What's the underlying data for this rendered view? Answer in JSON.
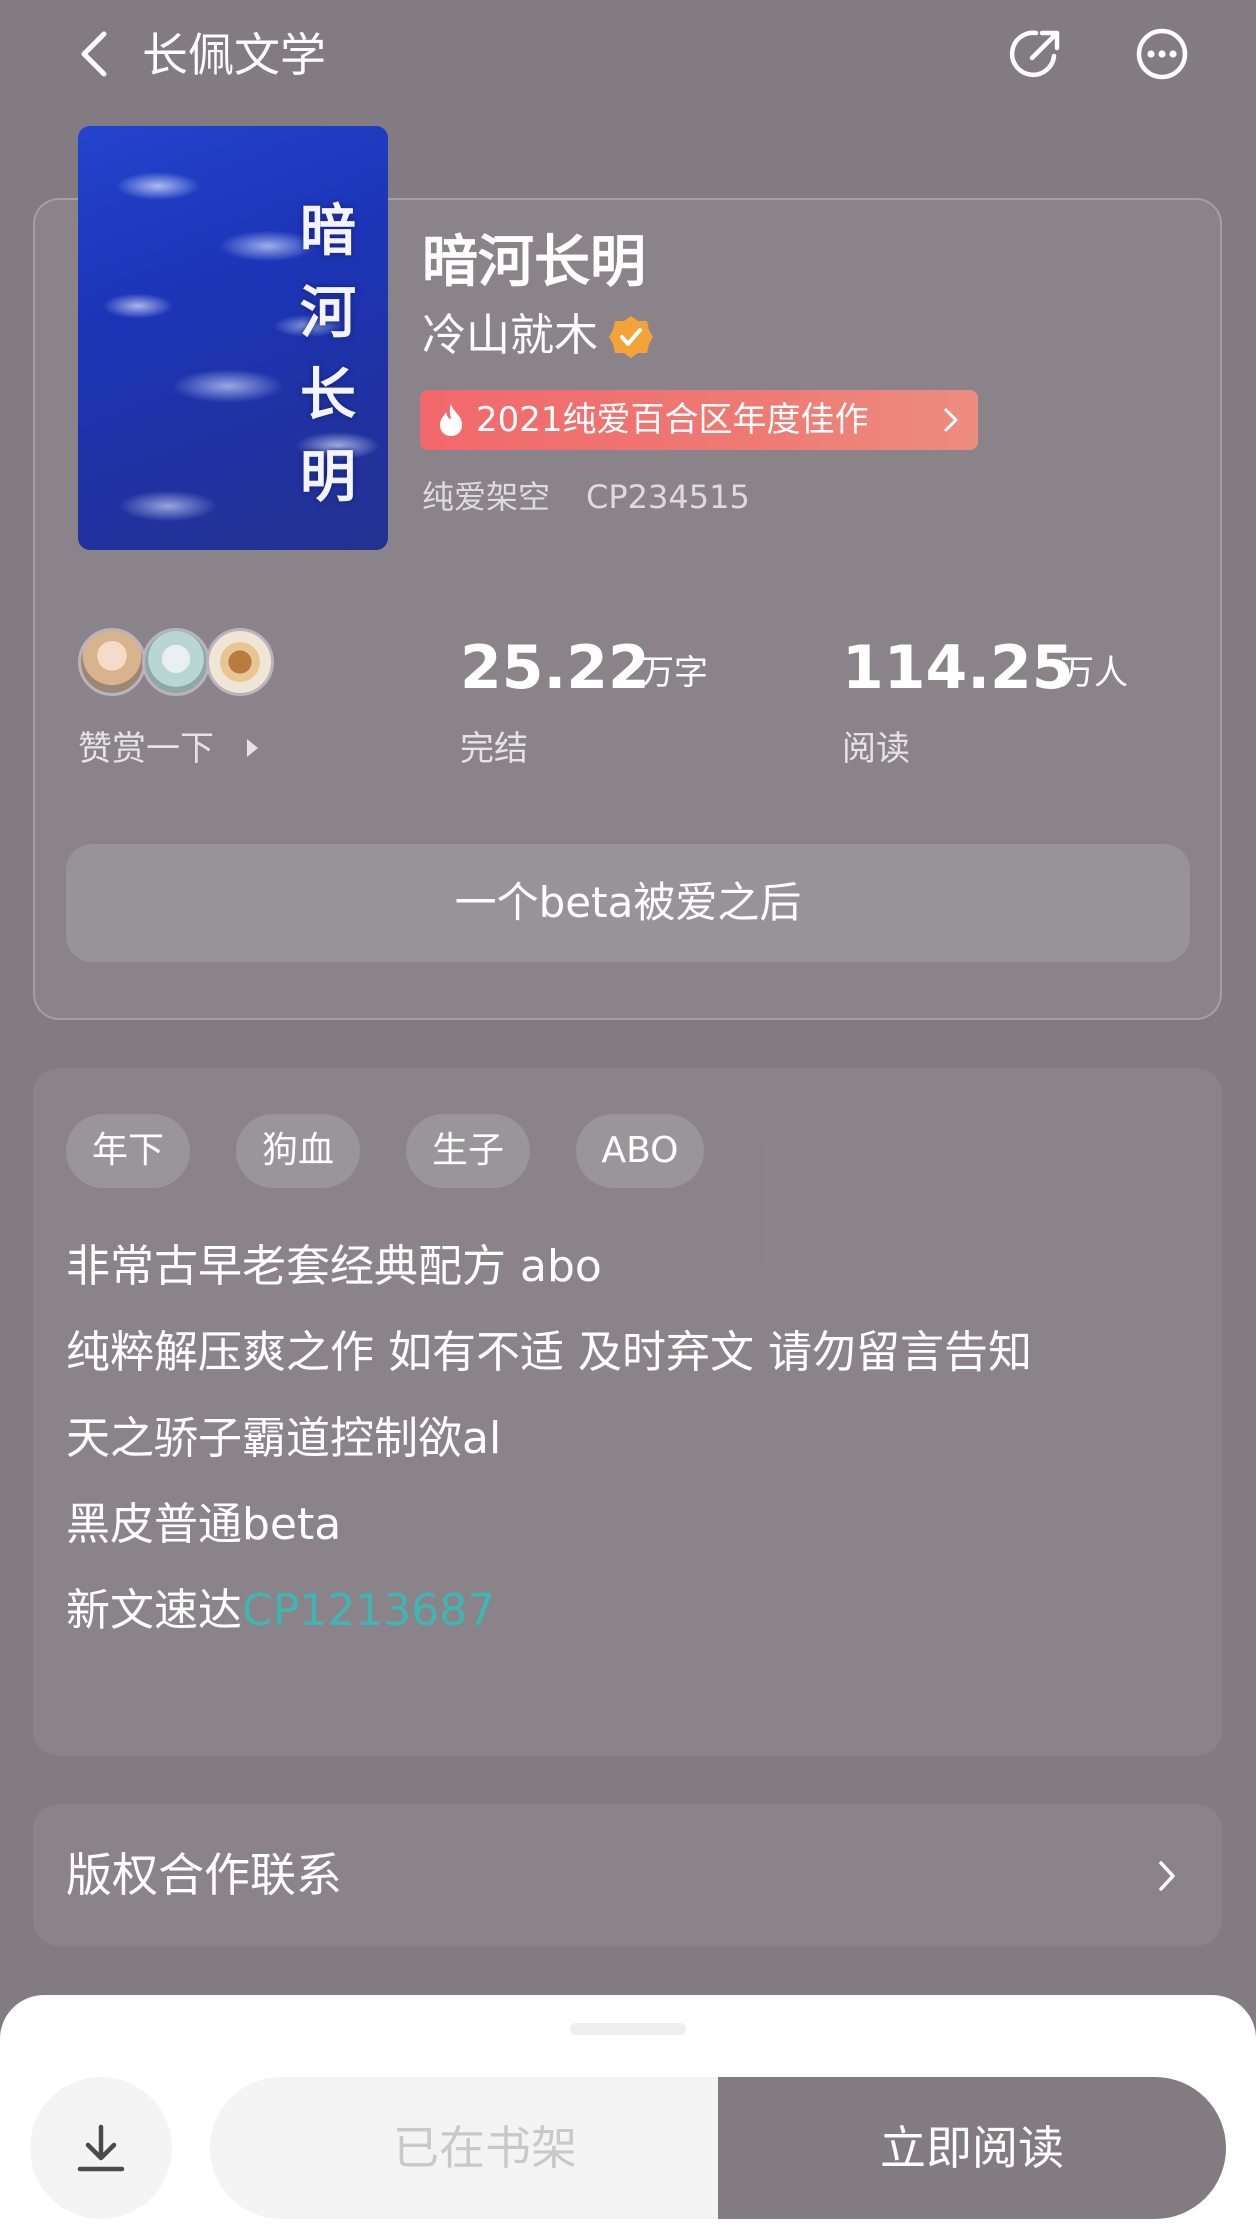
{
  "header": {
    "app_title": "长佩文学",
    "icons": [
      "back-icon",
      "share-icon",
      "more-icon"
    ]
  },
  "book": {
    "cover_title": "暗河长明",
    "title": "暗河长明",
    "author": "冷山就木",
    "award": "2021纯爱百合区年度佳作",
    "category": "纯爱架空",
    "cp_id": "CP234515",
    "tagline": "一个beta被爱之后"
  },
  "stats": {
    "reward_label": "赞赏一下",
    "words_value": "25.22",
    "words_unit": "万字",
    "words_label": "完结",
    "readers_value": "114.25",
    "readers_unit": "万人",
    "readers_label": "阅读"
  },
  "tags": [
    "年下",
    "狗血",
    "生子",
    "ABO"
  ],
  "description": {
    "line1": "非常古早老套经典配方 abo",
    "line2": "纯粹解压爽之作 如有不适 及时弃文 请勿留言告知",
    "line3": "天之骄子霸道控制欲al",
    "line4": "黑皮普通beta",
    "line5_prefix": "新文速达",
    "line5_link": "CP1213687"
  },
  "copyright": {
    "label": "版权合作联系"
  },
  "bottom_bar": {
    "shelf_label": "已在书架",
    "read_label": "立即阅读"
  },
  "colors": {
    "background": "#827b82",
    "award_badge": "#f2686c",
    "link": "#3fb6b2",
    "read_button": "#827b82"
  }
}
